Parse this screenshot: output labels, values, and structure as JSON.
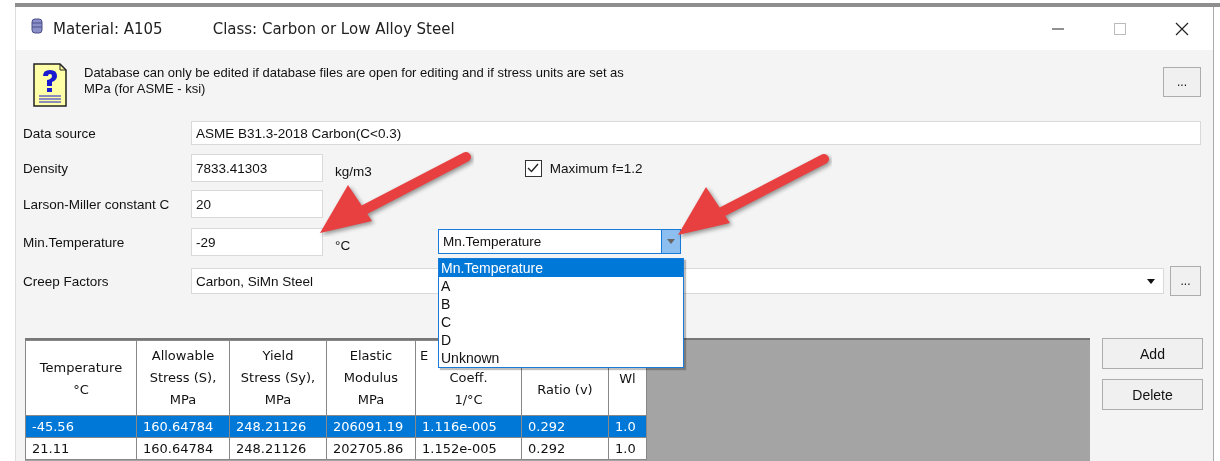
{
  "window": {
    "title": "Material: A105",
    "subtitle": "Class: Carbon or Low Alloy Steel"
  },
  "info": {
    "message": "Database can only be edited if database files are open for editing and if stress units are set as MPa (for ASME - ksi)",
    "more_button": "..."
  },
  "fields": [
    {
      "kind": "wide",
      "label": "Data source",
      "value": "ASME B31.3-2018 Carbon(C<0.3)"
    },
    {
      "kind": "short",
      "label": "Density",
      "value": "7833.41303",
      "unit": "kg/m3",
      "checkbox": {
        "label": "Maximum f=1.2",
        "checked": true
      }
    },
    {
      "kind": "short",
      "label": "Larson-Miller constant C",
      "value": "20"
    },
    {
      "kind": "short",
      "label": "Min.Temperature",
      "value": "-29",
      "unit": "°C",
      "dropdown": {
        "value": "Mn.Temperature",
        "expanded": true,
        "options": [
          {
            "label": "Mn.Temperature",
            "selected": true
          },
          {
            "label": "A",
            "selected": false
          },
          {
            "label": "B",
            "selected": false
          },
          {
            "label": "C",
            "selected": false
          },
          {
            "label": "D",
            "selected": false
          },
          {
            "label": "Unknown",
            "selected": false
          }
        ]
      }
    },
    {
      "kind": "combo",
      "label": "Creep Factors",
      "value": "Carbon, SiMn Steel",
      "more_button": "..."
    }
  ],
  "table": {
    "columns": [
      {
        "lines": [
          "Temperature",
          "°C"
        ]
      },
      {
        "lines": [
          "Allowable",
          "Stress (S),",
          "MPa"
        ]
      },
      {
        "lines": [
          "Yield",
          "Stress (Sy),",
          "MPa"
        ]
      },
      {
        "lines": [
          "Elastic",
          "Modulus",
          "MPa"
        ]
      },
      {
        "lines": [
          "E",
          "Coeff.",
          "1/°C"
        ]
      },
      {
        "lines": [
          "Ratio (v)"
        ]
      },
      {
        "lines": [
          "Wl"
        ]
      }
    ],
    "rows": [
      {
        "selected": true,
        "cells": [
          "-45.56",
          "160.64784",
          "248.21126",
          "206091.19",
          "1.116e-005",
          "0.292",
          "1.0"
        ]
      },
      {
        "selected": false,
        "cells": [
          "21.11",
          "160.64784",
          "248.21126",
          "202705.86",
          "1.152e-005",
          "0.292",
          "1.0"
        ]
      }
    ]
  },
  "buttons": [
    "Add",
    "Delete"
  ],
  "annotations": [
    {
      "kind": "arrow"
    },
    {
      "kind": "arrow"
    }
  ]
}
